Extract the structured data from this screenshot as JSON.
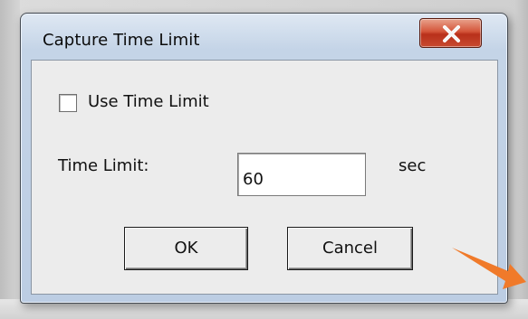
{
  "window": {
    "title": "Capture Time Limit",
    "close_icon": "close-x-icon"
  },
  "options": {
    "use_time_limit_label": "Use Time Limit",
    "use_time_limit_checked": false
  },
  "time_limit": {
    "label": "Time Limit:",
    "value": "60",
    "unit": "sec"
  },
  "buttons": {
    "ok": "OK",
    "cancel": "Cancel"
  },
  "annotation": {
    "icon": "orange-arrow-icon",
    "color": "#f07a2a"
  }
}
